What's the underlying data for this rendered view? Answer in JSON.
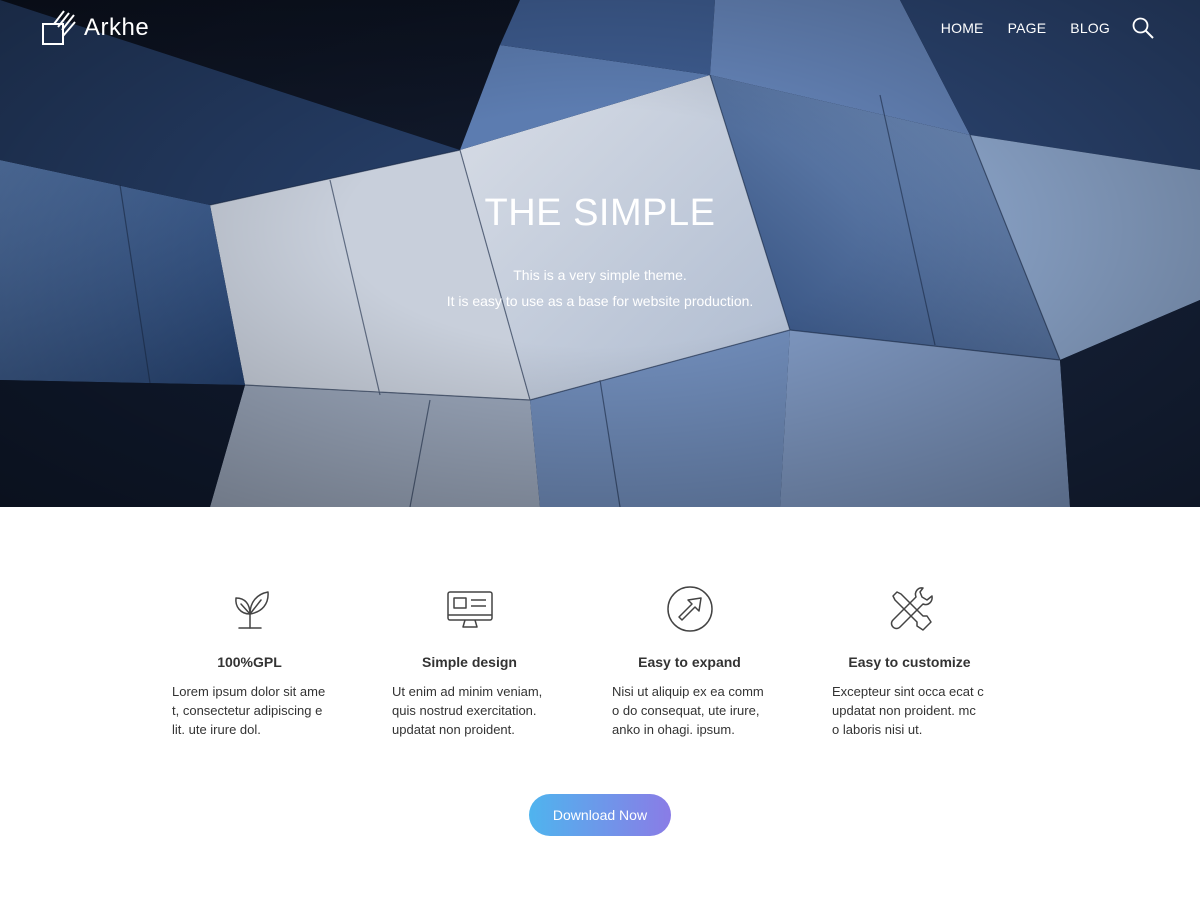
{
  "header": {
    "logo_text": "Arkhe",
    "nav": [
      {
        "label": "HOME"
      },
      {
        "label": "PAGE"
      },
      {
        "label": "BLOG"
      }
    ]
  },
  "hero": {
    "title": "THE SIMPLE",
    "subtitle_line1": "This is a very simple theme.",
    "subtitle_line2": "It is easy to use as a base for website production."
  },
  "features": [
    {
      "icon": "leaf-icon",
      "title": "100%GPL",
      "lines": [
        "Lorem ipsum dolor sit ame",
        "t, consectetur adipiscing e",
        "lit. ute irure dol."
      ]
    },
    {
      "icon": "monitor-icon",
      "title": "Simple design",
      "lines": [
        "Ut enim ad minim veniam,",
        "quis nostrud exercitation.",
        "updatat non proident."
      ]
    },
    {
      "icon": "expand-arrow-icon",
      "title": "Easy to expand",
      "lines": [
        "Nisi ut aliquip ex ea comm",
        "o do consequat, ute irure,",
        "anko in ohagi. ipsum."
      ]
    },
    {
      "icon": "tools-icon",
      "title": "Easy to customize",
      "lines": [
        "Excepteur sint occa ecat c",
        "updatat non proident. mc",
        "o laboris nisi ut."
      ]
    }
  ],
  "cta": {
    "label": "Download Now"
  },
  "colors": {
    "button_start": "#4fb4ee",
    "button_end": "#8a7ce6",
    "text": "#333333"
  }
}
